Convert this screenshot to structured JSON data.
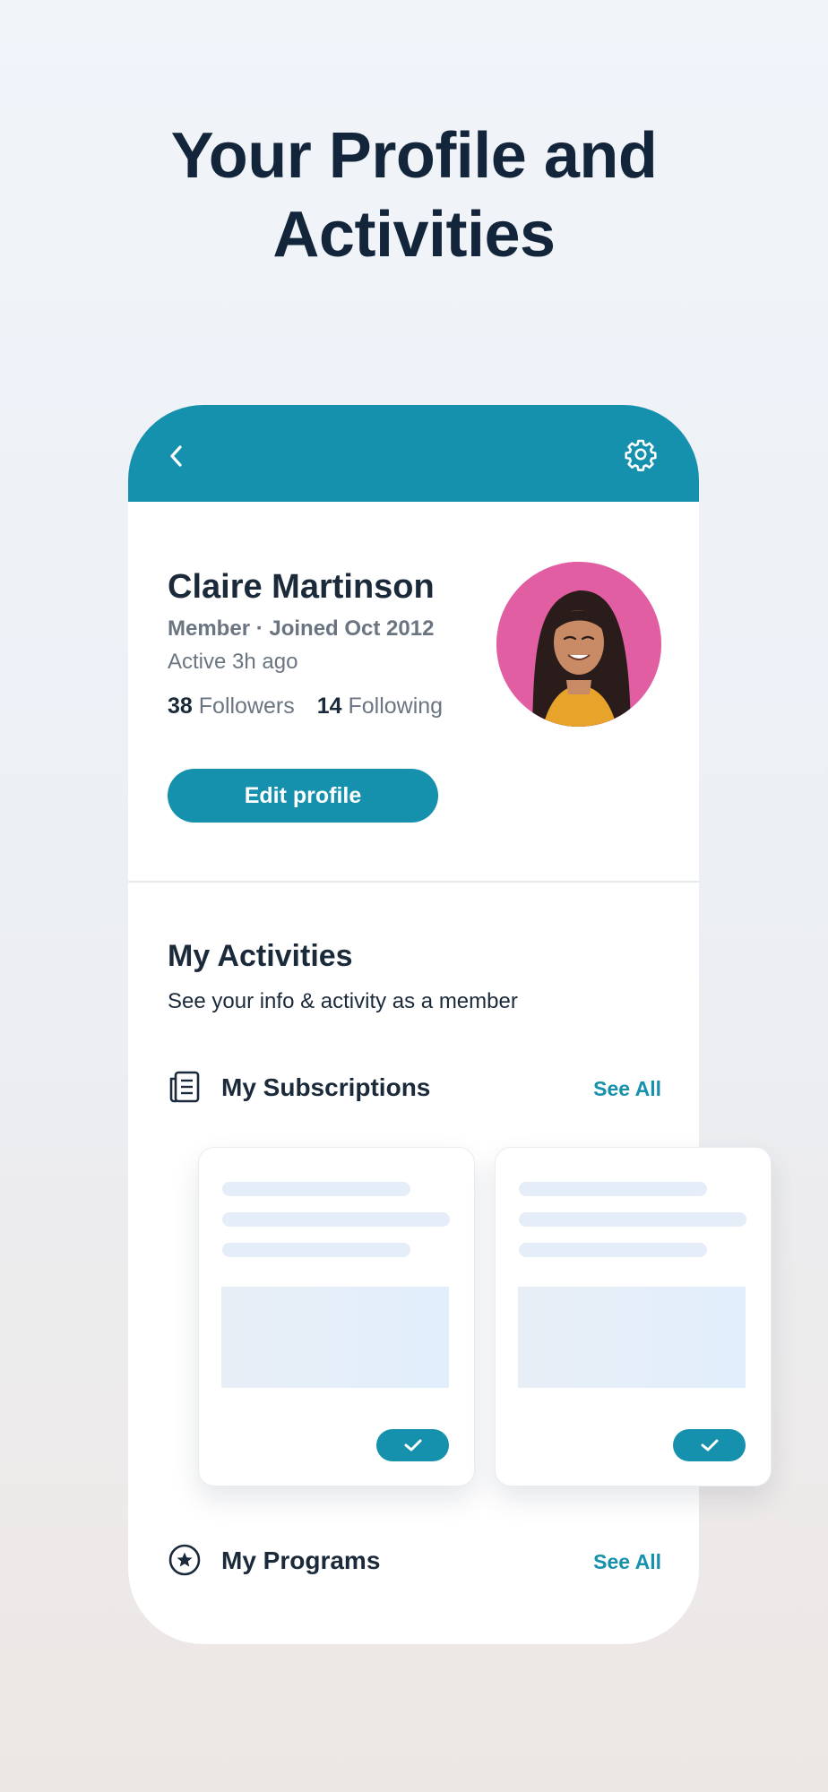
{
  "headline": {
    "line1": "Your Profile and",
    "line2": "Activities"
  },
  "topbar": {
    "back_icon": "chevron-left-icon",
    "settings_icon": "gear-icon",
    "color": "#1590ad"
  },
  "profile": {
    "name": "Claire Martinson",
    "meta": "Member · Joined Oct 2012",
    "active": "Active 3h ago",
    "followers_count": "38",
    "followers_label": "Followers",
    "following_count": "14",
    "following_label": "Following",
    "edit_label": "Edit profile"
  },
  "activities": {
    "title": "My Activities",
    "subtitle": "See your info & activity as a member",
    "subscriptions": {
      "icon": "newspaper-icon",
      "label": "My Subscriptions",
      "see_all": "See All"
    },
    "programs": {
      "icon": "star-badge-icon",
      "label": "My Programs",
      "see_all": "See All"
    }
  },
  "cards": [
    {
      "check_icon": "check-icon"
    },
    {
      "check_icon": "check-icon"
    }
  ]
}
